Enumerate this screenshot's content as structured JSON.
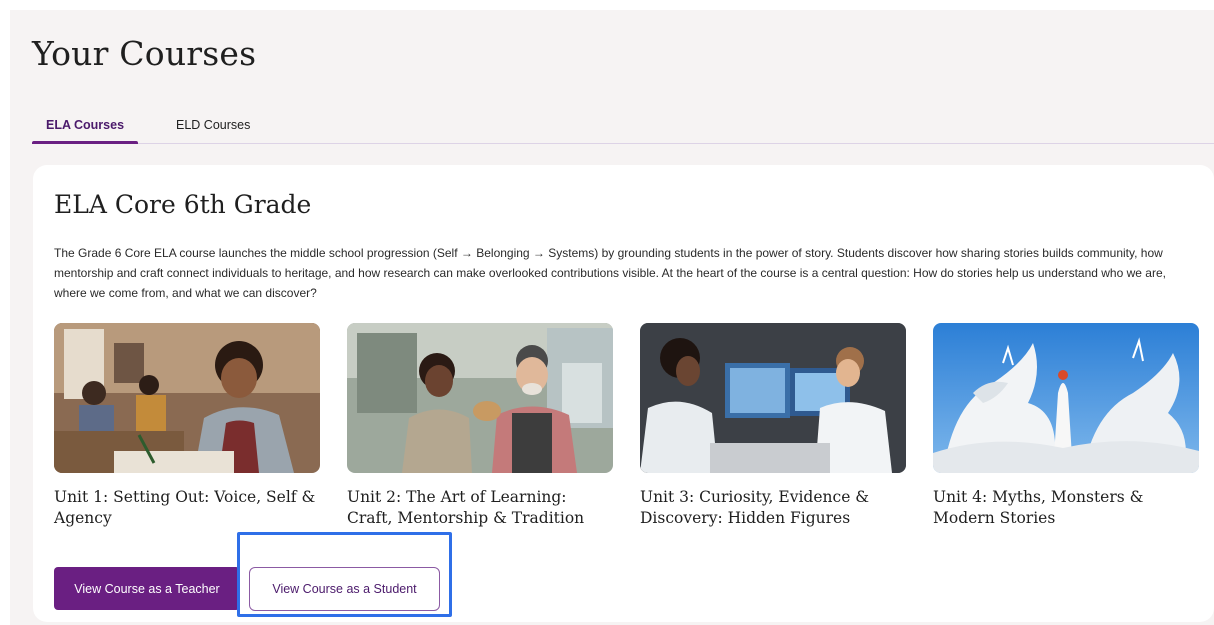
{
  "page": {
    "title": "Your Courses"
  },
  "tabs": [
    {
      "label": "ELA Courses",
      "active": true
    },
    {
      "label": "ELD Courses",
      "active": false
    }
  ],
  "course": {
    "title": "ELA Core 6th Grade",
    "description": "The Grade 6 Core ELA course launches the middle school progression (Self → Belonging → Systems) by grounding students in the power of story. Students discover how sharing stories builds community, how mentorship and craft connect individuals to heritage, and how research can make overlooked contributions visible. At the heart of the course is a central question: How do stories help us understand who we are, where we come from, and what we can discover?",
    "units": [
      {
        "title": "Unit 1: Setting Out: Voice, Self & Agency",
        "image": "classroom-student-photo"
      },
      {
        "title": "Unit 2: The Art of Learning: Craft, Mentorship & Tradition",
        "image": "workshop-mentor-photo"
      },
      {
        "title": "Unit 3: Curiosity, Evidence & Discovery: Hidden Figures",
        "image": "scientists-computer-photo"
      },
      {
        "title": "Unit 4: Myths, Monsters & Modern Stories",
        "image": "white-dragon-sculpture-photo"
      }
    ]
  },
  "actions": {
    "teacher_label": "View Course as a Teacher",
    "student_label": "View Course as a Student"
  },
  "colors": {
    "brand": "#6a1f82",
    "highlight": "#2f6fe8",
    "page_bg": "#f6f3f3"
  }
}
